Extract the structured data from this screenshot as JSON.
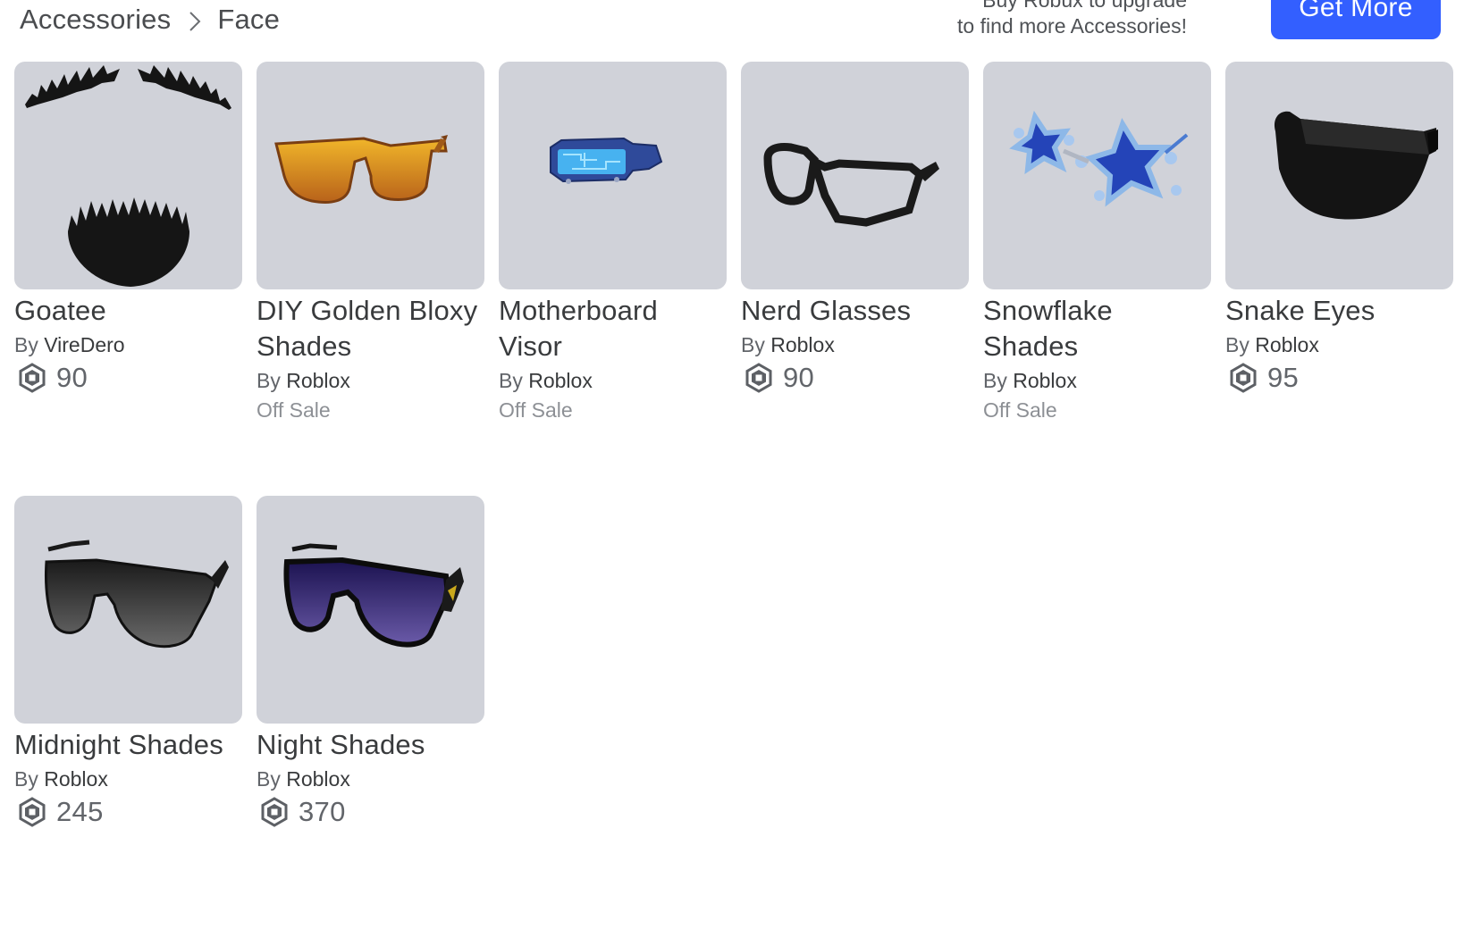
{
  "breadcrumb": {
    "parent": "Accessories",
    "current": "Face"
  },
  "promo": {
    "line1": "Buy Robux to upgrade",
    "line2": "to find more Accessories!",
    "button_label": "Get More"
  },
  "colors": {
    "accent": "#335fff",
    "thumb_bg": "#d0d2d9"
  },
  "items": [
    {
      "name": "Goatee",
      "by_prefix": "By",
      "creator": "VireDero",
      "price": "90",
      "status": "",
      "icon": "goatee-image"
    },
    {
      "name": "DIY Golden Bloxy Shades",
      "by_prefix": "By",
      "creator": "Roblox",
      "price": "",
      "status": "Off Sale",
      "icon": "golden-shades-image"
    },
    {
      "name": "Motherboard Visor",
      "by_prefix": "By",
      "creator": "Roblox",
      "price": "",
      "status": "Off Sale",
      "icon": "motherboard-visor-image"
    },
    {
      "name": "Nerd Glasses",
      "by_prefix": "By",
      "creator": "Roblox",
      "price": "90",
      "status": "",
      "icon": "nerd-glasses-image"
    },
    {
      "name": "Snowflake Shades",
      "by_prefix": "By",
      "creator": "Roblox",
      "price": "",
      "status": "Off Sale",
      "icon": "snowflake-shades-image"
    },
    {
      "name": "Snake Eyes",
      "by_prefix": "By",
      "creator": "Roblox",
      "price": "95",
      "status": "",
      "icon": "snake-eyes-image"
    },
    {
      "name": "Midnight Shades",
      "by_prefix": "By",
      "creator": "Roblox",
      "price": "245",
      "status": "",
      "icon": "midnight-shades-image"
    },
    {
      "name": "Night Shades",
      "by_prefix": "By",
      "creator": "Roblox",
      "price": "370",
      "status": "",
      "icon": "night-shades-image"
    }
  ]
}
